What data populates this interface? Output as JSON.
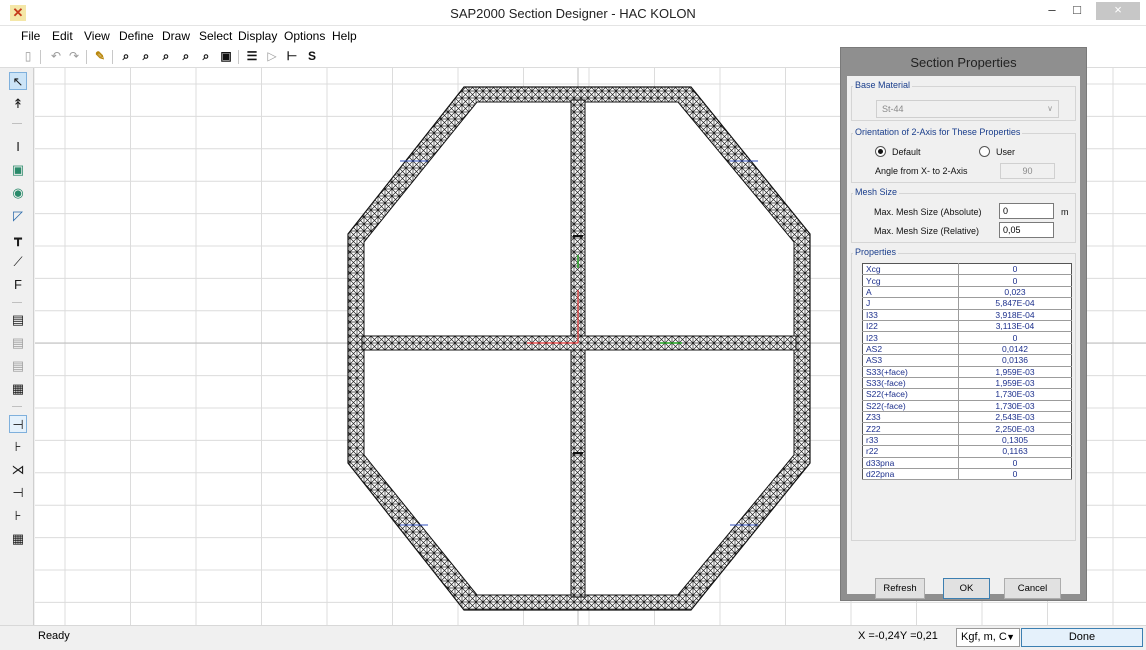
{
  "window": {
    "title": "SAP2000 Section Designer - HAC KOLON",
    "app_icon": "sap2000-logo-icon",
    "controls": {
      "minimize": "–",
      "maximize": "□",
      "close": "×"
    }
  },
  "menu": [
    "File",
    "Edit",
    "View",
    "Define",
    "Draw",
    "Select",
    "Display",
    "Options",
    "Help"
  ],
  "toolbar": {
    "icons": [
      "new-file-icon",
      "undo-icon",
      "redo-icon",
      "pencil-icon",
      "zoom-window-icon",
      "zoom-in-icon",
      "zoom-out-icon",
      "zoom-previous-icon",
      "zoom-restore-icon",
      "zoom-all-icon",
      "section-icon",
      "shape-icon",
      "axis-icon",
      "stress-icon"
    ]
  },
  "left_tools": [
    "pointer-tool-icon",
    "reshape-tool-icon",
    "draw-i-section-icon",
    "draw-rectangle-icon",
    "draw-circle-icon",
    "draw-polygon-icon",
    "draw-tee-icon",
    "draw-line-icon",
    "draw-rebar-icon",
    "show-all-icon",
    "show-previous-icon",
    "clear-selection-icon",
    "hatch-icon",
    "snap-intersection-icon",
    "snap-end-icon",
    "snap-cross-icon",
    "snap-perp-icon",
    "snap-edge-icon",
    "snap-grid-icon"
  ],
  "status": {
    "text": "Ready",
    "coords": "X =-0,24Y =0,21",
    "units": "Kgf, m, C",
    "done_button": "Done"
  },
  "dialog": {
    "title": "Section Properties",
    "base_material": {
      "label": "Base Material",
      "value": "St-44"
    },
    "orientation": {
      "label": "Orientation of 2-Axis for These Properties",
      "default_label": "Default",
      "user_label": "User",
      "selected": "Default",
      "angle_label": "Angle from X- to 2-Axis",
      "angle_value": "90"
    },
    "mesh": {
      "label": "Mesh Size",
      "absolute_label": "Max. Mesh Size (Absolute)",
      "absolute_value": "0",
      "absolute_unit": "m",
      "relative_label": "Max. Mesh Size (Relative)",
      "relative_value": "0,05"
    },
    "properties_label": "Properties",
    "properties": [
      [
        "Xcg",
        "0"
      ],
      [
        "Ycg",
        "0"
      ],
      [
        "A",
        "0,023"
      ],
      [
        "J",
        "5,847E-04"
      ],
      [
        "I33",
        "3,918E-04"
      ],
      [
        "I22",
        "3,113E-04"
      ],
      [
        "I23",
        "0"
      ],
      [
        "AS2",
        "0,0142"
      ],
      [
        "AS3",
        "0,0136"
      ],
      [
        "S33(+face)",
        "1,959E-03"
      ],
      [
        "S33(-face)",
        "1,959E-03"
      ],
      [
        "S22(+face)",
        "1,730E-03"
      ],
      [
        "S22(-face)",
        "1,730E-03"
      ],
      [
        "Z33",
        "2,543E-03"
      ],
      [
        "Z22",
        "2,250E-03"
      ],
      [
        "r33",
        "0,1305"
      ],
      [
        "r22",
        "0,1163"
      ],
      [
        "d33pna",
        "0"
      ],
      [
        "d22pna",
        "0"
      ]
    ],
    "buttons": {
      "refresh": "Refresh",
      "ok": "OK",
      "cancel": "Cancel"
    }
  }
}
